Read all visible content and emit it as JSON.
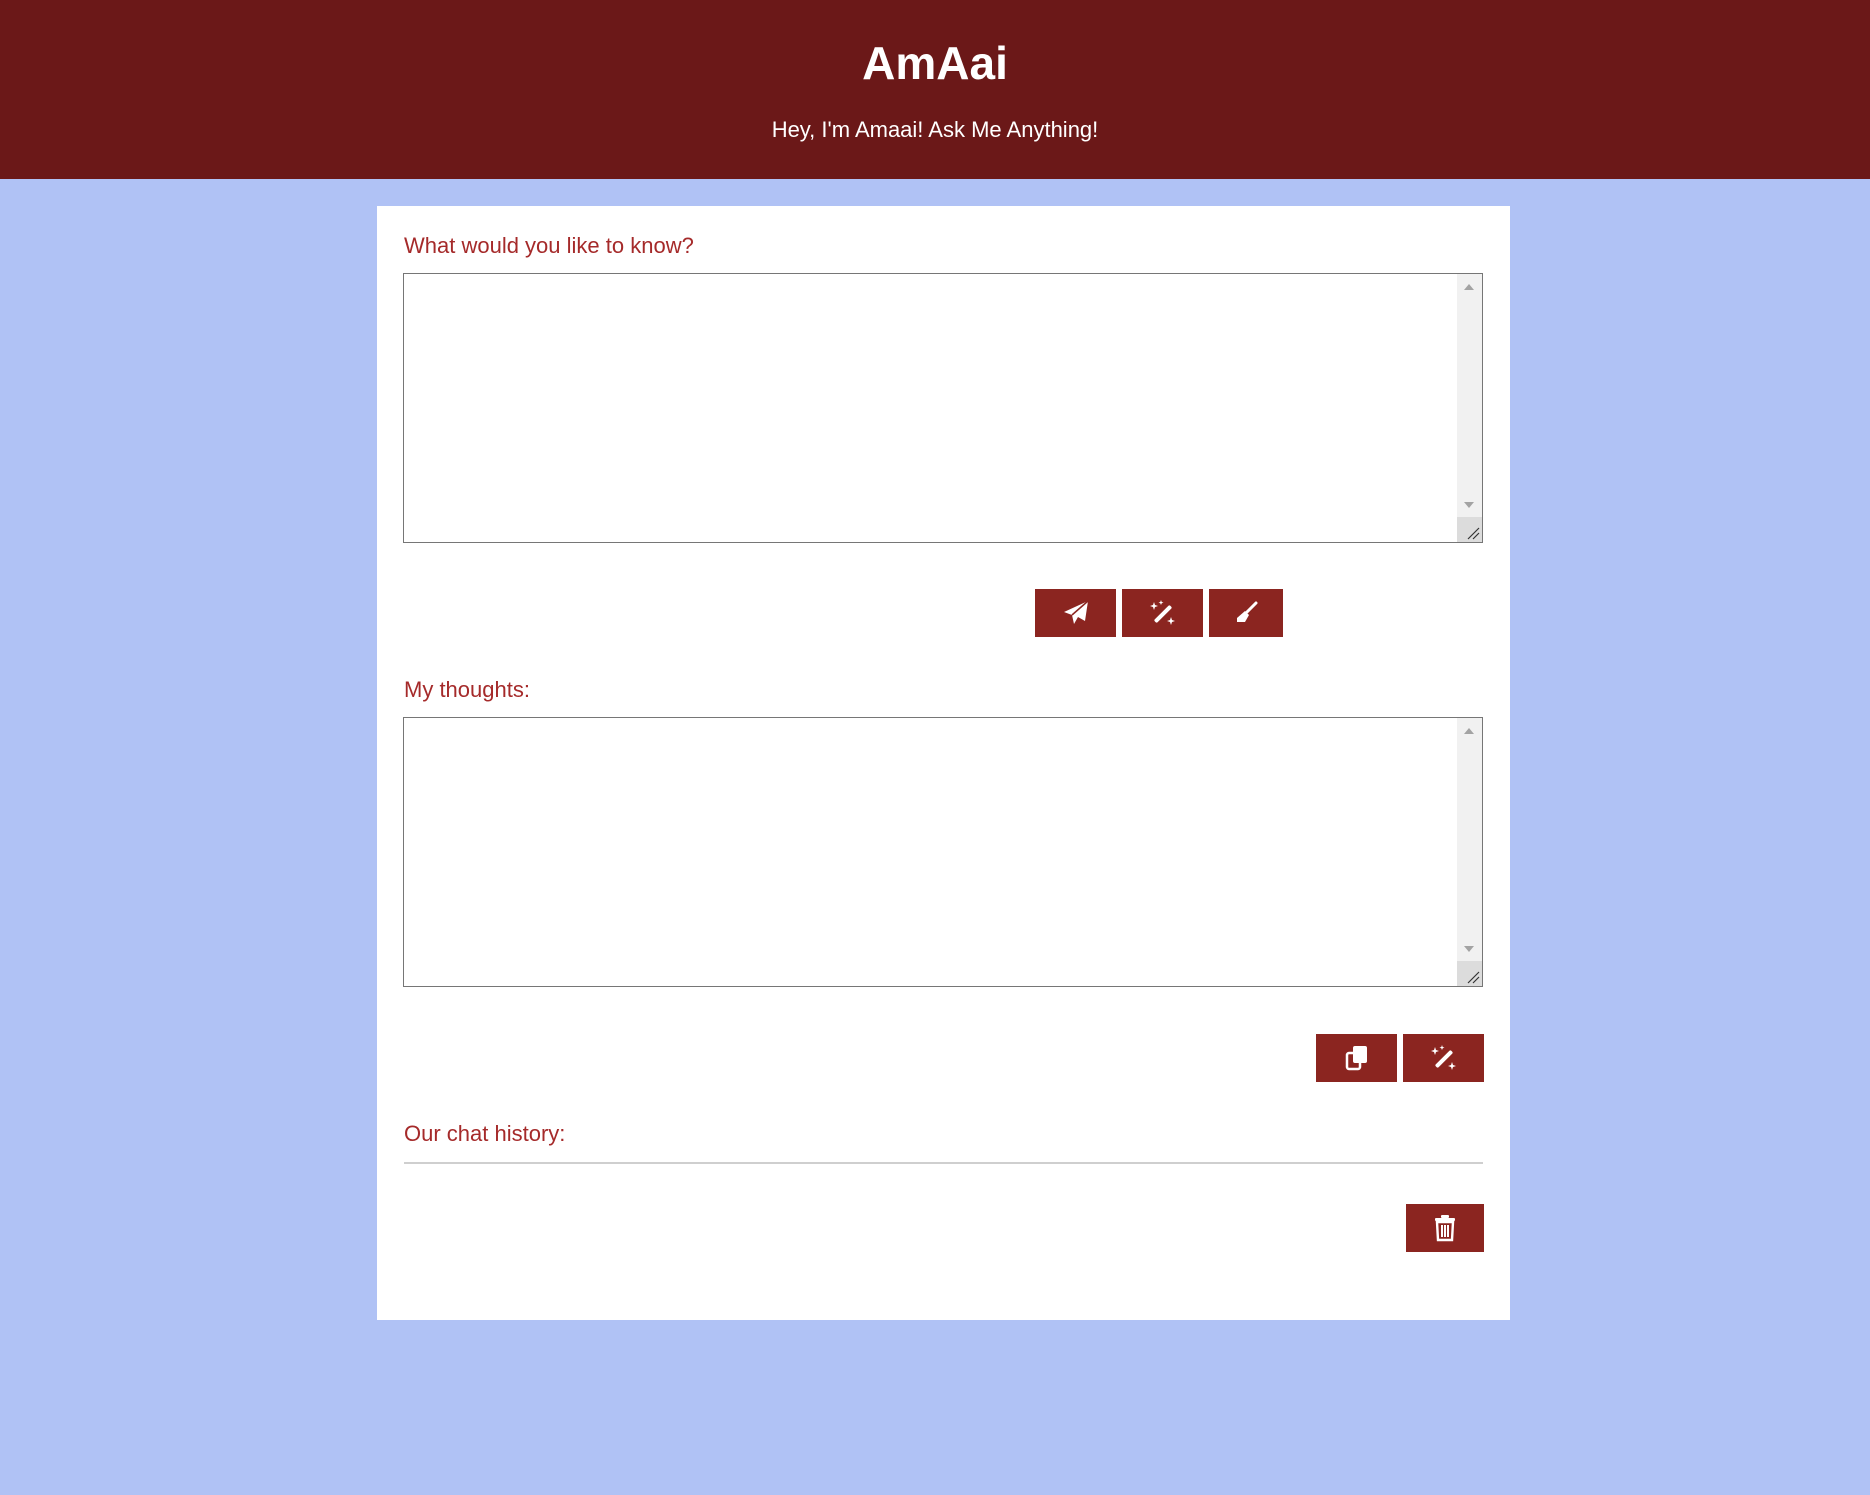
{
  "header": {
    "title": "AmAai",
    "subtitle": "Hey, I'm Amaai! Ask Me Anything!"
  },
  "question": {
    "label": "What would you like to know?",
    "value": "",
    "buttons": [
      {
        "icon": "paper-plane-icon"
      },
      {
        "icon": "magic-wand-icon"
      },
      {
        "icon": "broom-icon"
      }
    ]
  },
  "thoughts": {
    "label": "My thoughts:",
    "value": "",
    "buttons": [
      {
        "icon": "copy-icon"
      },
      {
        "icon": "magic-wand-icon"
      }
    ]
  },
  "history": {
    "label": "Our chat history:",
    "buttons": [
      {
        "icon": "trash-icon"
      }
    ]
  },
  "colors": {
    "header_bg": "#6b1818",
    "page_bg": "#b0c2f5",
    "accent": "#8b2520",
    "label_text": "#a52a2a"
  }
}
